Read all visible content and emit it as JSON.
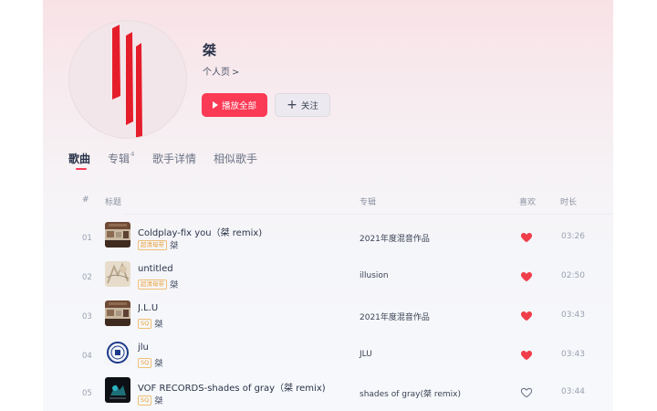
{
  "artist": {
    "name": "桀",
    "profile_link": "个人页",
    "profile_chevron": ">"
  },
  "buttons": {
    "play_all": "播放全部",
    "follow": "关注",
    "follow_icon": "+"
  },
  "tabs": [
    {
      "label": "歌曲",
      "active": true
    },
    {
      "label": "专辑",
      "count": "4"
    },
    {
      "label": "歌手详情"
    },
    {
      "label": "相似歌手"
    }
  ],
  "table": {
    "headers": {
      "index": "#",
      "title": "标题",
      "album": "专辑",
      "like": "喜欢",
      "duration": "时长"
    },
    "rows": [
      {
        "index": "01",
        "title": "Coldplay-fix you（桀 remix)",
        "badge": "超清母带",
        "singer": "桀",
        "album": "2021年度混音作品",
        "liked": true,
        "duration": "03:26",
        "cover": "cover-collage"
      },
      {
        "index": "02",
        "title": "untitled",
        "badge": "超清母带",
        "singer": "桀",
        "album": "illusion",
        "liked": true,
        "duration": "02:50",
        "cover": "cover-sketch"
      },
      {
        "index": "03",
        "title": "J.L.U",
        "badge": "SQ",
        "singer": "桀",
        "album": "2021年度混音作品",
        "liked": true,
        "duration": "03:43",
        "cover": "cover-collage"
      },
      {
        "index": "04",
        "title": "jlu",
        "badge": "SQ",
        "singer": "桀",
        "album": "JLU",
        "liked": true,
        "duration": "03:43",
        "cover": "cover-seal"
      },
      {
        "index": "05",
        "title": "VOF RECORDS-shades of gray（桀 remix)",
        "badge": "SQ",
        "singer": "桀",
        "album": "shades of gray(桀 remix)",
        "liked": false,
        "duration": "03:44",
        "cover": "cover-dark"
      }
    ]
  },
  "colors": {
    "accent": "#fb3a55",
    "heart_filled": "#ef3e4a",
    "badge": "#e8a23c"
  }
}
